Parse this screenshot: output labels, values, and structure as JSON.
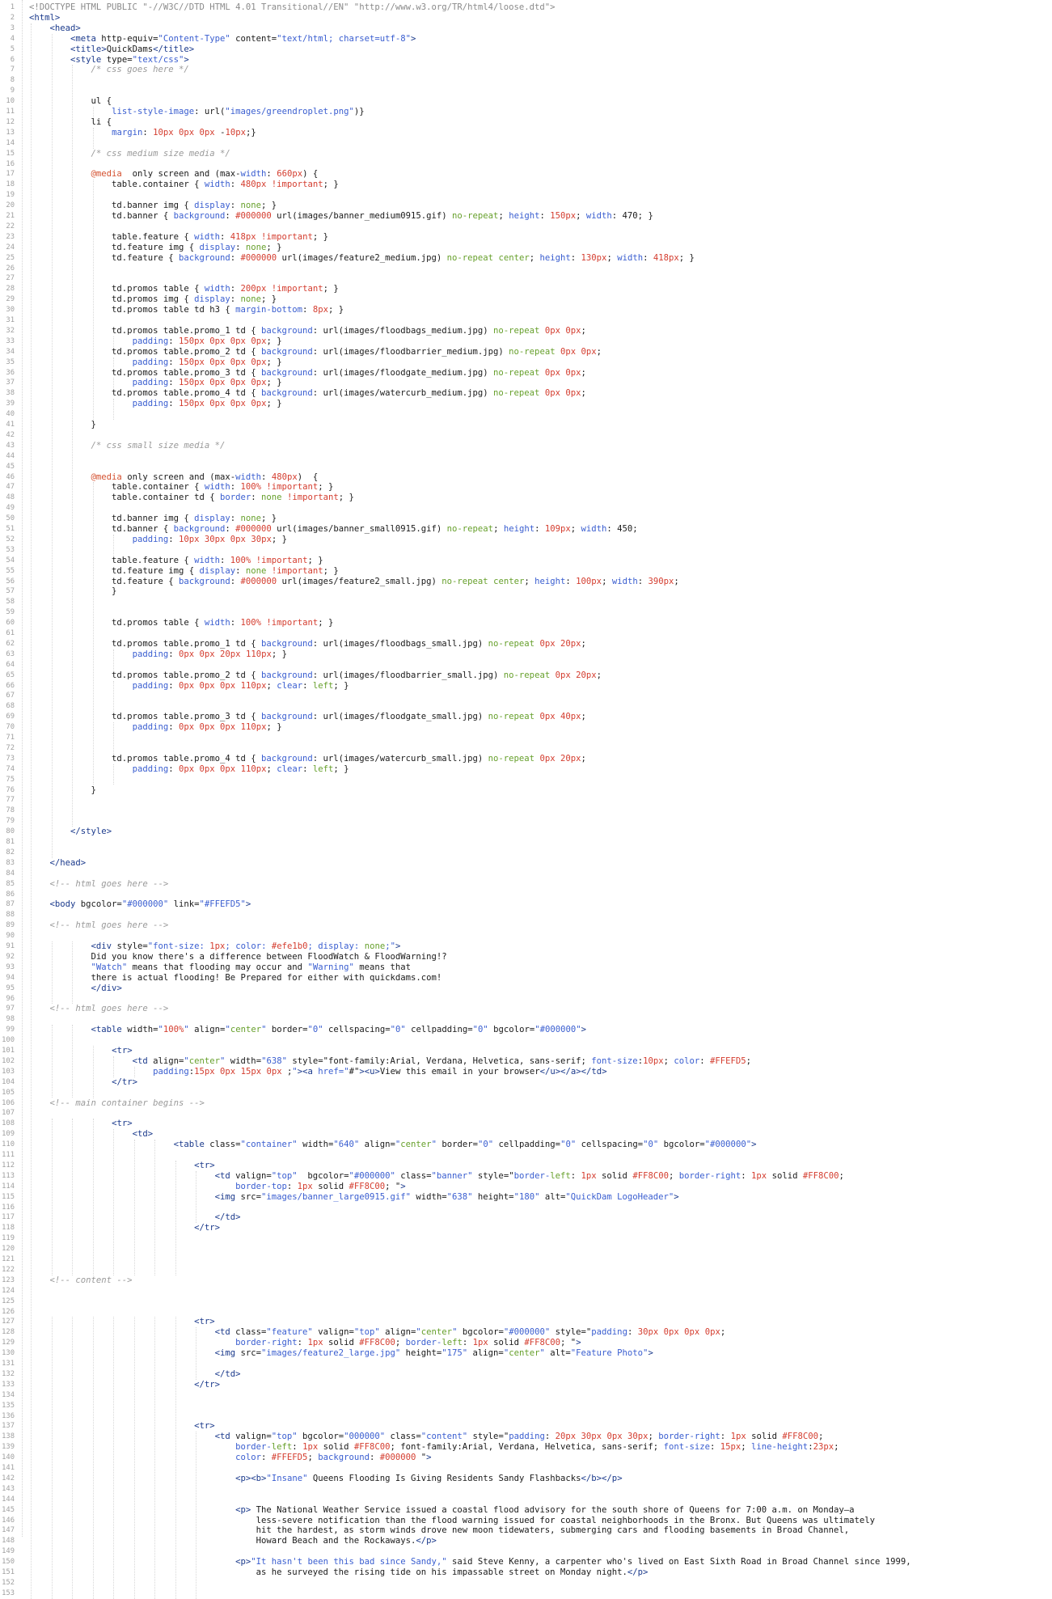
{
  "editor": {
    "lines": [
      "<!DOCTYPE HTML PUBLIC \"-//W3C//DTD HTML 4.01 Transitional//EN\" \"http://www.w3.org/TR/html4/loose.dtd\">",
      "<html>",
      "    <head>",
      "        <meta http-equiv=\"Content-Type\" content=\"text/html; charset=utf-8\">",
      "        <title>QuickDams</title>",
      "        <style type=\"text/css\">",
      "            /* css goes here */",
      "",
      "",
      "            ul {",
      "                list-style-image: url(\"images/greendroplet.png\")}",
      "            li {",
      "                margin: 10px 0px 0px -10px;}",
      "",
      "            /* css medium size media */",
      "",
      "            @media  only screen and (max-width: 660px) {",
      "                table.container { width: 480px !important; }",
      "",
      "                td.banner img { display: none; }",
      "                td.banner { background: #000000 url(images/banner_medium0915.gif) no-repeat; height: 150px; width: 470; }",
      "",
      "                table.feature { width: 418px !important; }",
      "                td.feature img { display: none; }",
      "                td.feature { background: #000000 url(images/feature2_medium.jpg) no-repeat center; height: 130px; width: 418px; }",
      "",
      "",
      "                td.promos table { width: 200px !important; }",
      "                td.promos img { display: none; }",
      "                td.promos table td h3 { margin-bottom: 8px; }",
      "",
      "                td.promos table.promo_1 td { background: url(images/floodbags_medium.jpg) no-repeat 0px 0px;",
      "                    padding: 150px 0px 0px 0px; }",
      "                td.promos table.promo_2 td { background: url(images/floodbarrier_medium.jpg) no-repeat 0px 0px;",
      "                    padding: 150px 0px 0px 0px; }",
      "                td.promos table.promo_3 td { background: url(images/floodgate_medium.jpg) no-repeat 0px 0px;",
      "                    padding: 150px 0px 0px 0px; }",
      "                td.promos table.promo_4 td { background: url(images/watercurb_medium.jpg) no-repeat 0px 0px;",
      "                    padding: 150px 0px 0px 0px; }",
      "",
      "            }",
      "",
      "            /* css small size media */",
      "",
      "",
      "            @media only screen and (max-width: 480px)  {",
      "                table.container { width: 100% !important; }",
      "                table.container td { border: none !important; }",
      "",
      "                td.banner img { display: none; }",
      "                td.banner { background: #000000 url(images/banner_small0915.gif) no-repeat; height: 109px; width: 450;",
      "                    padding: 10px 30px 0px 30px; }",
      "",
      "                table.feature { width: 100% !important; }",
      "                td.feature img { display: none !important; }",
      "                td.feature { background: #000000 url(images/feature2_small.jpg) no-repeat center; height: 100px; width: 390px;",
      "                }",
      "",
      "",
      "                td.promos table { width: 100% !important; }",
      "",
      "                td.promos table.promo_1 td { background: url(images/floodbags_small.jpg) no-repeat 0px 20px;",
      "                    padding: 0px 0px 20px 110px; }",
      "",
      "                td.promos table.promo_2 td { background: url(images/floodbarrier_small.jpg) no-repeat 0px 20px;",
      "                    padding: 0px 0px 0px 110px; clear: left; }",
      "",
      "",
      "                td.promos table.promo_3 td { background: url(images/floodgate_small.jpg) no-repeat 0px 40px;",
      "                    padding: 0px 0px 0px 110px; }",
      "",
      "",
      "                td.promos table.promo_4 td { background: url(images/watercurb_small.jpg) no-repeat 0px 20px;",
      "                    padding: 0px 0px 0px 110px; clear: left; }",
      "",
      "            }",
      "",
      "",
      "",
      "        </style>",
      "",
      "",
      "    </head>",
      "",
      "    <!-- html goes here -->",
      "",
      "    <body bgcolor=\"#000000\" link=\"#FFEFD5\">",
      "",
      "    <!-- html goes here -->",
      "",
      "            <div style=\"font-size: 1px; color: #efe1b0; display: none;\">",
      "            Did you know there's a difference between FloodWatch & FloodWarning!?",
      "            \"Watch\" means that flooding may occur and \"Warning\" means that",
      "            there is actual flooding! Be Prepared for either with quickdams.com!",
      "            </div>",
      "",
      "    <!-- html goes here -->",
      "",
      "            <table width=\"100%\" align=\"center\" border=\"0\" cellspacing=\"0\" cellpadding=\"0\" bgcolor=\"#000000\">",
      "",
      "                <tr>",
      "                    <td align=\"center\" width=\"638\" style=\"font-family:Arial, Verdana, Helvetica, sans-serif; font-size:10px; color: #FFEFD5;",
      "                        padding:15px 0px 15px 0px ;\"><a href=\"#\"><u>View this email in your browser</u></a></td>",
      "                </tr>",
      "",
      "    <!-- main container begins -->",
      "",
      "                <tr>",
      "                    <td>",
      "                            <table class=\"container\" width=\"640\" align=\"center\" border=\"0\" cellpadding=\"0\" cellspacing=\"0\" bgcolor=\"#000000\">",
      "",
      "                                <tr>",
      "                                    <td valign=\"top\"  bgcolor=\"#000000\" class=\"banner\" style=\"border-left: 1px solid #FF8C00; border-right: 1px solid #FF8C00;",
      "                                        border-top: 1px solid #FF8C00; \">",
      "                                    <img src=\"images/banner_large0915.gif\" width=\"638\" height=\"180\" alt=\"QuickDam LogoHeader\">",
      "",
      "                                    </td>",
      "                                </tr>",
      "",
      "",
      "",
      "",
      "    <!-- content -->",
      "",
      "",
      "",
      "                                <tr>",
      "                                    <td class=\"feature\" valign=\"top\" align=\"center\" bgcolor=\"#000000\" style=\"padding: 30px 0px 0px 0px;",
      "                                        border-right: 1px solid #FF8C00; border-left: 1px solid #FF8C00; \">",
      "                                    <img src=\"images/feature2_large.jpg\" height=\"175\" align=\"center\" alt=\"Feature Photo\">",
      "",
      "                                    </td>",
      "                                </tr>",
      "",
      "",
      "",
      "                                <tr>",
      "                                    <td valign=\"top\" bgcolor=\"000000\" class=\"content\" style=\"padding: 20px 30px 0px 30px; border-right: 1px solid #FF8C00;",
      "                                        border-left: 1px solid #FF8C00; font-family:Arial, Verdana, Helvetica, sans-serif; font-size: 15px; line-height:23px;",
      "                                        color: #FFEFD5; background: #000000 \">",
      "",
      "                                        <p><b>\"Insane\" Queens Flooding Is Giving Residents Sandy Flashbacks</b></p>",
      "",
      "",
      "                                        <p> The National Weather Service issued a coastal flood advisory for the south shore of Queens for 7:00 a.m. on Monday—a",
      "                                            less-severe notification than the flood warning issued for coastal neighborhoods in the Bronx. But Queens was ultimately",
      "                                            hit the hardest, as storm winds drove new moon tidewaters, submerging cars and flooding basements in Broad Channel,",
      "                                            Howard Beach and the Rockaways.</p>",
      "",
      "                                        <p>\"It hasn't been this bad since Sandy,\" said Steve Kenny, a carpenter who's lived on East Sixth Road in Broad Channel since 1999,",
      "                                            as he surveyed the rising tide on his impassable street on Monday night.</p>",
      "",
      ""
    ]
  }
}
